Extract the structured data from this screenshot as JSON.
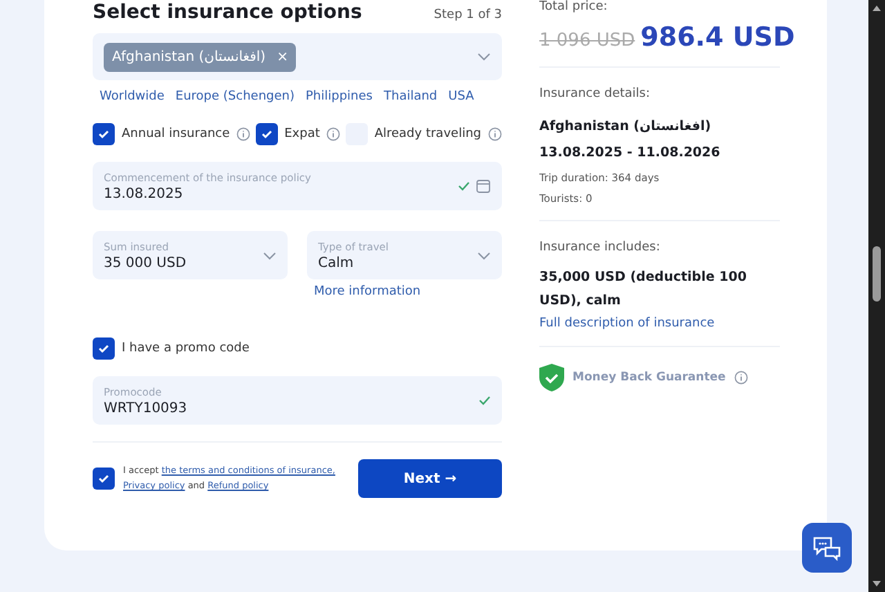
{
  "form": {
    "title": "Select insurance options",
    "step": "Step 1 of 3",
    "country_field": {
      "chips": [
        {
          "label": "Afghanistan (افغانستان)",
          "remove": "×"
        }
      ]
    },
    "quick_links": [
      "Worldwide",
      "Europe (Schengen)",
      "Philippines",
      "Thailand",
      "USA"
    ],
    "options": [
      {
        "label": "Annual insurance",
        "checked": true
      },
      {
        "label": "Expat",
        "checked": true
      },
      {
        "label": "Already traveling",
        "checked": false
      }
    ],
    "start_date": {
      "label": "Commencement of the insurance policy",
      "value": "13.08.2025",
      "valid": true
    },
    "sum_insured": {
      "label": "Sum insured",
      "value": "35 000 USD"
    },
    "travel_type": {
      "label": "Type of travel",
      "value": "Calm"
    },
    "more_info": "More information",
    "promo_toggle": {
      "label": "I have a promo code",
      "checked": true
    },
    "promo_field": {
      "label": "Promocode",
      "value": "WRTY10093",
      "valid": true
    },
    "consent": {
      "checked": true,
      "text": "I accept ",
      "link1": "the terms and conditions of insurance,",
      "link2": "Privacy policy",
      "and": " and ",
      "link3": "Refund policy"
    },
    "next_button": "Next →"
  },
  "summary": {
    "total_label": "Total price:",
    "old_price": "1 096 USD",
    "price": "986.4 USD",
    "details_label": "Insurance details:",
    "country": "Afghanistan (افغانستان)",
    "dates": "13.08.2025 - 11.08.2026",
    "duration": "Trip duration: 364 days",
    "tourists": "Tourists: 0",
    "includes_label": "Insurance includes:",
    "includes": "35,000 USD (deductible 100 USD), calm",
    "description_link": "Full description of insurance",
    "guarantee": "Money Back Guarantee"
  }
}
